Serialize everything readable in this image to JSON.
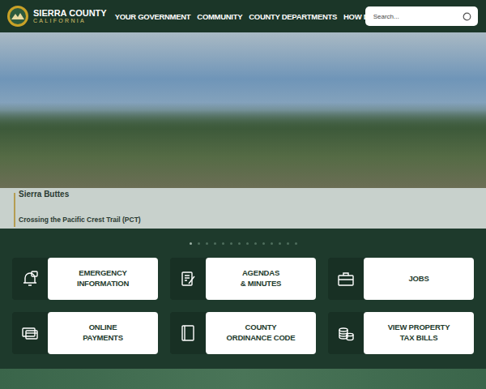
{
  "header": {
    "logo": {
      "title": "SIERRA COUNTY",
      "subtitle": "CALIFORNIA"
    },
    "nav": [
      "YOUR GOVERNMENT",
      "COMMUNITY",
      "COUNTY DEPARTMENTS",
      "HOW DO I"
    ],
    "search": {
      "placeholder": "Search..."
    }
  },
  "hero": {
    "caption": {
      "title": "Sierra Buttes",
      "subtitle": "Crossing the Pacific Crest Trail (PCT)"
    },
    "slides": [
      {
        "selected": true
      },
      {
        "selected": false
      },
      {
        "selected": false
      },
      {
        "selected": false
      },
      {
        "selected": false
      },
      {
        "selected": false
      },
      {
        "selected": false
      },
      {
        "selected": false
      },
      {
        "selected": false
      },
      {
        "selected": false
      },
      {
        "selected": false
      },
      {
        "selected": false
      },
      {
        "selected": false
      },
      {
        "selected": false
      }
    ]
  },
  "tiles": [
    {
      "lines": [
        "EMERGENCY",
        "INFORMATION"
      ]
    },
    {
      "lines": [
        "AGENDAS",
        "& MINUTES"
      ]
    },
    {
      "lines": [
        "JOBS"
      ]
    },
    {
      "lines": [
        "ONLINE",
        "PAYMENTS"
      ]
    },
    {
      "lines": [
        "COUNTY",
        "ORDINANCE CODE"
      ]
    },
    {
      "lines": [
        "VIEW PROPERTY",
        "TAX BILLS"
      ]
    }
  ]
}
